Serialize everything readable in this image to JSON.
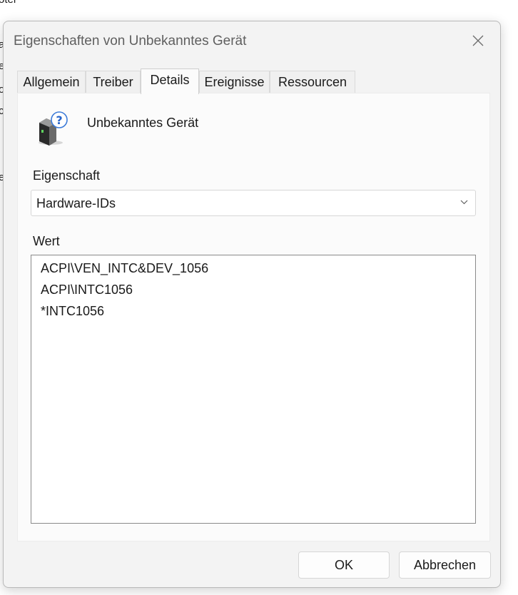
{
  "background_fragments": [
    "oter",
    "a",
    "e",
    "o",
    "c",
    "e"
  ],
  "dialog": {
    "title": "Eigenschaften von Unbekanntes Gerät",
    "close_icon": "close-icon",
    "tabs": [
      {
        "label": "Allgemein",
        "active": false
      },
      {
        "label": "Treiber",
        "active": false
      },
      {
        "label": "Details",
        "active": true
      },
      {
        "label": "Ereignisse",
        "active": false
      },
      {
        "label": "Ressourcen",
        "active": false
      }
    ],
    "device": {
      "icon": "unknown-device-icon",
      "name": "Unbekanntes Gerät"
    },
    "property": {
      "label": "Eigenschaft",
      "selected": "Hardware-IDs"
    },
    "value": {
      "label": "Wert",
      "items": [
        "ACPI\\VEN_INTC&DEV_1056",
        "ACPI\\INTC1056",
        "*INTC1056"
      ]
    },
    "buttons": {
      "ok": "OK",
      "cancel": "Abbrechen"
    }
  }
}
